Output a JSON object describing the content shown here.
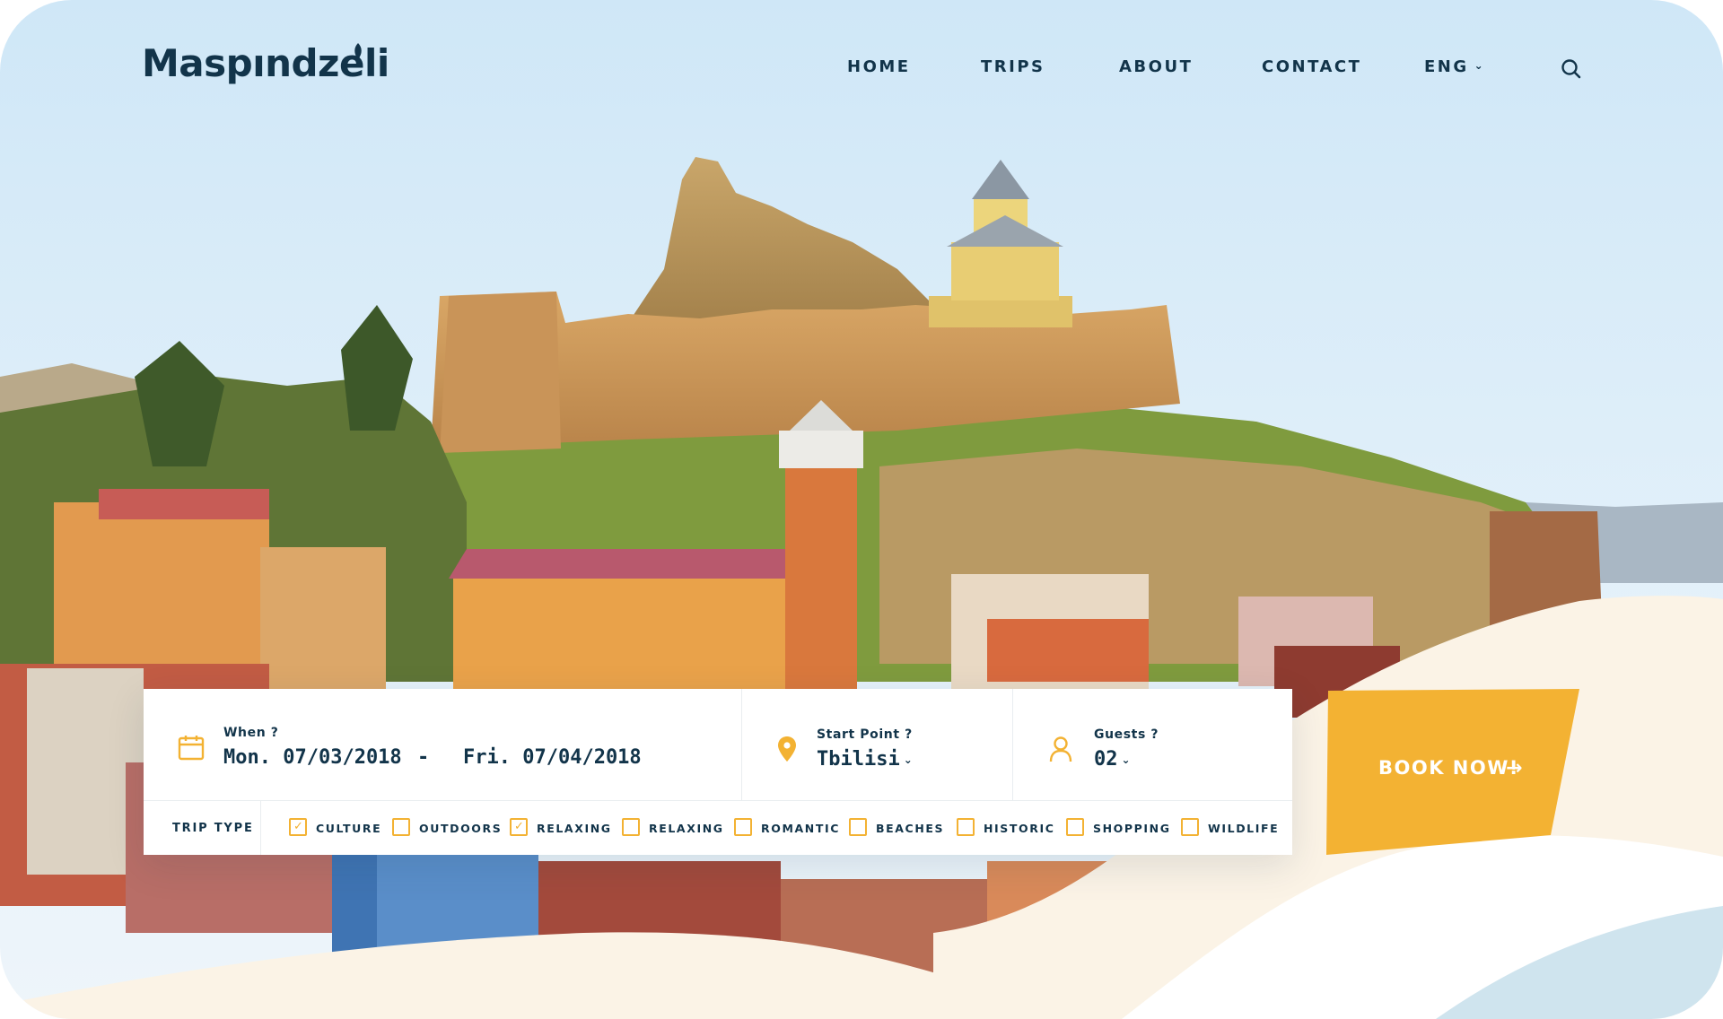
{
  "brand": {
    "name": "Maspındzeli"
  },
  "nav": {
    "items": [
      "HOME",
      "TRIPS",
      "ABOUT",
      "CONTACT"
    ],
    "language": "ENG",
    "search_icon": "search-icon"
  },
  "booking": {
    "when": {
      "label": "When ?",
      "start": "Mon. 07/03/2018",
      "separator": "-",
      "end": "Fri. 07/04/2018",
      "icon": "calendar-icon"
    },
    "start_point": {
      "label": "Start Point ?",
      "value": "Tbilisi",
      "icon": "map-pin-icon"
    },
    "guests": {
      "label": "Guests ?",
      "value": "02",
      "icon": "user-icon"
    },
    "trip_type": {
      "label": "TRIP TYPE",
      "options": [
        {
          "label": "CULTURE",
          "checked": true
        },
        {
          "label": "OUTDOORS",
          "checked": false
        },
        {
          "label": "RELAXING",
          "checked": true
        },
        {
          "label": "RELAXING",
          "checked": false
        },
        {
          "label": "ROMANTIC",
          "checked": false
        },
        {
          "label": "BEACHES",
          "checked": false
        },
        {
          "label": "HISTORIC",
          "checked": false
        },
        {
          "label": "SHOPPING",
          "checked": false
        },
        {
          "label": "WILDLIFE",
          "checked": false
        }
      ]
    },
    "book_button": {
      "label": "BOOK NOW!",
      "icon": "arrow-right-icon"
    }
  },
  "colors": {
    "primary_text": "#12344a",
    "accent": "#f3b233",
    "sky": "#bfe0f5",
    "cream": "#fbf3e6",
    "teal_wave": "#cfe4ee"
  }
}
